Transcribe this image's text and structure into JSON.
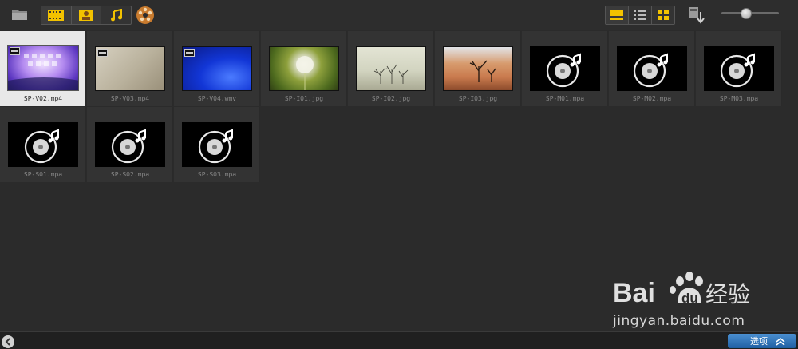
{
  "toolbar": {
    "folder_icon": "folder-icon",
    "filters": [
      {
        "icon": "video-filter-icon",
        "active": true
      },
      {
        "icon": "photo-filter-icon",
        "active": true
      },
      {
        "icon": "audio-filter-icon",
        "active": false
      }
    ],
    "transition_icon": "film-reel-icon",
    "views": [
      {
        "icon": "view-strip-icon",
        "active": true
      },
      {
        "icon": "view-list-icon",
        "active": false
      },
      {
        "icon": "view-grid-icon",
        "active": false
      }
    ],
    "import_icon": "sort-import-icon",
    "zoom_slider_value": 0.42
  },
  "media": [
    {
      "name": "SP-V02.mp4",
      "kind": "video",
      "style": "t-v02",
      "selected": true
    },
    {
      "name": "SP-V03.mp4",
      "kind": "video",
      "style": "t-v03",
      "selected": false
    },
    {
      "name": "SP-V04.wmv",
      "kind": "video",
      "style": "t-v04",
      "selected": false
    },
    {
      "name": "SP-I01.jpg",
      "kind": "image",
      "style": "t-i01",
      "selected": false
    },
    {
      "name": "SP-I02.jpg",
      "kind": "image",
      "style": "t-i02",
      "selected": false
    },
    {
      "name": "SP-I03.jpg",
      "kind": "image",
      "style": "t-i03",
      "selected": false
    },
    {
      "name": "SP-M01.mpa",
      "kind": "audio",
      "style": "t-audio",
      "selected": false
    },
    {
      "name": "SP-M02.mpa",
      "kind": "audio",
      "style": "t-audio",
      "selected": false
    },
    {
      "name": "SP-M03.mpa",
      "kind": "audio",
      "style": "t-audio",
      "selected": false
    },
    {
      "name": "SP-S01.mpa",
      "kind": "audio",
      "style": "t-audio",
      "selected": false
    },
    {
      "name": "SP-S02.mpa",
      "kind": "audio",
      "style": "t-audio",
      "selected": false
    },
    {
      "name": "SP-S03.mpa",
      "kind": "audio",
      "style": "t-audio",
      "selected": false
    }
  ],
  "statusbar": {
    "options_label": "选项",
    "back_icon": "chevron-left-icon",
    "expand_icon": "double-chevron-up-icon"
  },
  "watermark": {
    "brand": "Bai",
    "brand2": "du",
    "brand_cn": "经验",
    "site": "jingyan.baidu.com"
  },
  "colors": {
    "accent_yellow": "#f2c200",
    "options_blue": "#2d6fb4",
    "background": "#2b2b2b"
  }
}
